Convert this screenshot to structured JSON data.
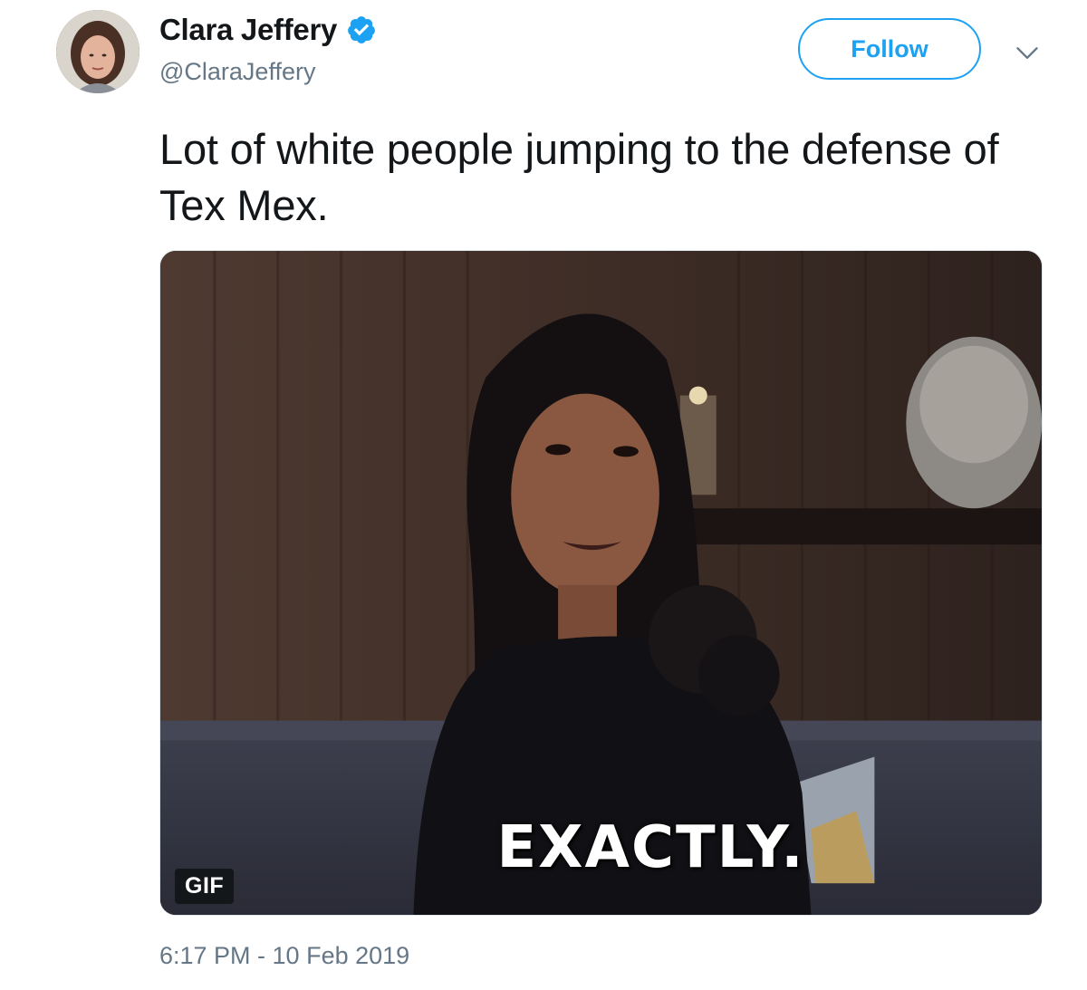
{
  "author": {
    "name": "Clara Jeffery",
    "handle": "@ClaraJeffery",
    "verified": true
  },
  "actions": {
    "follow_label": "Follow"
  },
  "tweet": {
    "text": "Lot of white people jumping to the defense of Tex Mex.",
    "media": {
      "badge": "GIF",
      "caption": "EXACTLY."
    },
    "timestamp": "6:17 PM - 10 Feb 2019"
  },
  "colors": {
    "accent": "#1da1f2",
    "text_primary": "#14171a",
    "text_secondary": "#657786"
  },
  "icons": {
    "verified": "verified-badge-icon",
    "menu": "chevron-down-icon"
  }
}
